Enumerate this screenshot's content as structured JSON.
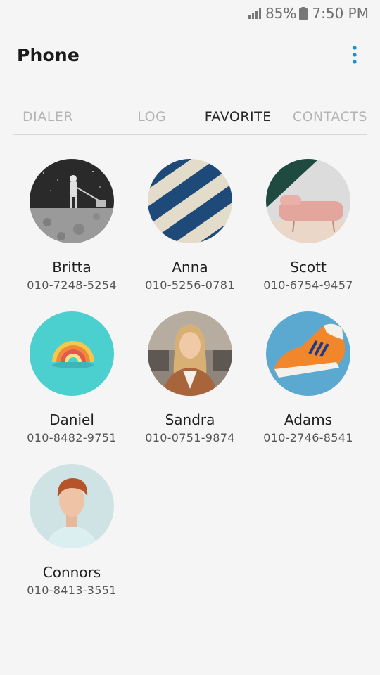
{
  "status": {
    "battery": "85%",
    "time": "7:50 PM"
  },
  "app": {
    "title": "Phone"
  },
  "tabs": [
    {
      "label": "DIALER"
    },
    {
      "label": "LOG"
    },
    {
      "label": "FAVORITE"
    },
    {
      "label": "CONTACTS"
    }
  ],
  "favorites": [
    {
      "name": "Britta",
      "number": "010-7248-5254"
    },
    {
      "name": "Anna",
      "number": "010-5256-0781"
    },
    {
      "name": "Scott",
      "number": "010-6754-9457"
    },
    {
      "name": "Daniel",
      "number": "010-8482-9751"
    },
    {
      "name": "Sandra",
      "number": "010-0751-9874"
    },
    {
      "name": "Adams",
      "number": "010-2746-8541"
    },
    {
      "name": "Connors",
      "number": "010-8413-3551"
    }
  ]
}
